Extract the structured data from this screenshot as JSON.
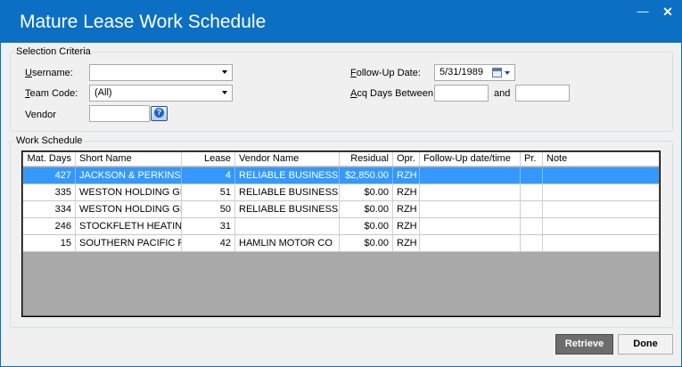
{
  "window": {
    "title": "Mature Lease Work Schedule",
    "minimize_glyph": "—",
    "close_glyph": "✕"
  },
  "criteria": {
    "legend": "Selection Criteria",
    "username": {
      "label_u": "U",
      "label_rest": "sername:",
      "value": ""
    },
    "team_code": {
      "label_u": "T",
      "label_rest": "eam Code:",
      "value": "(All)"
    },
    "vendor": {
      "label": "Vendor",
      "value": ""
    },
    "follow_up_date": {
      "label_u": "F",
      "label_rest": "ollow-Up Date:",
      "value": "5/31/1989"
    },
    "acq_days": {
      "label_u": "A",
      "label_rest": "cq Days Between",
      "from": "",
      "and_label": "and",
      "to": ""
    },
    "help_glyph": "?"
  },
  "work": {
    "legend": "Work Schedule",
    "columns": [
      "Mat. Days",
      "Short Name",
      "Lease",
      "Vendor Name",
      "Residual",
      "Opr.",
      "Follow-Up date/time",
      "Pr.",
      "Note"
    ],
    "rows": [
      {
        "mat_days": "427",
        "short_name": "JACKSON & PERKINS",
        "lease": "4",
        "vendor_name": "RELIABLE BUSINESS E...",
        "residual": "$2,850.00",
        "opr": "RZH",
        "follow_up": "",
        "pr": "",
        "note": "",
        "selected": true
      },
      {
        "mat_days": "335",
        "short_name": "WESTON HOLDING GR...",
        "lease": "51",
        "vendor_name": "RELIABLE BUSINESS E...",
        "residual": "$0.00",
        "opr": "RZH",
        "follow_up": "",
        "pr": "",
        "note": "",
        "selected": false
      },
      {
        "mat_days": "334",
        "short_name": "WESTON HOLDING GR...",
        "lease": "50",
        "vendor_name": "RELIABLE BUSINESS E...",
        "residual": "$0.00",
        "opr": "RZH",
        "follow_up": "",
        "pr": "",
        "note": "",
        "selected": false
      },
      {
        "mat_days": "246",
        "short_name": "STOCKFLETH HEATING",
        "lease": "31",
        "vendor_name": "",
        "residual": "$0.00",
        "opr": "RZH",
        "follow_up": "",
        "pr": "",
        "note": "",
        "selected": false
      },
      {
        "mat_days": "15",
        "short_name": "SOUTHERN PACIFIC RR",
        "lease": "42",
        "vendor_name": "HAMLIN MOTOR CO",
        "residual": "$0.00",
        "opr": "RZH",
        "follow_up": "",
        "pr": "",
        "note": "",
        "selected": false
      }
    ]
  },
  "buttons": {
    "retrieve": "Retrieve",
    "done": "Done"
  },
  "colors": {
    "titlebar": "#0b70c3",
    "selected_row": "#3399ff",
    "grid_empty": "#a9a9a9",
    "retrieve_button": "#6d6d6d"
  }
}
